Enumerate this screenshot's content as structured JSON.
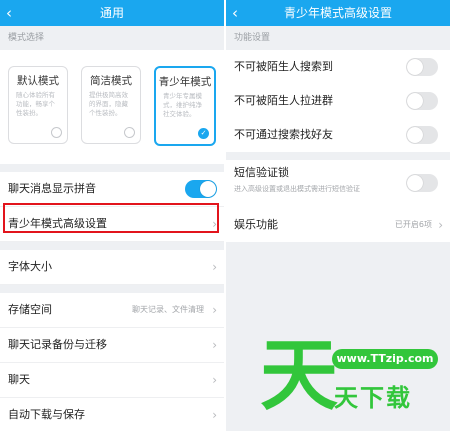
{
  "left": {
    "nav": {
      "back_icon": "‹",
      "title": "通用"
    },
    "mode_section_label": "模式选择",
    "modes": [
      {
        "title": "默认模式",
        "desc": "随心体验所有功能，畅享个性装扮。",
        "selected": false
      },
      {
        "title": "简洁模式",
        "desc": "提供极简高效的界面，隐藏个性装扮。",
        "selected": false
      },
      {
        "title": "青少年模式",
        "desc": "青少年专属模式，维护纯净社交体验。",
        "selected": true
      }
    ],
    "pinyin_row": {
      "label": "聊天消息显示拼音",
      "toggle_on": true
    },
    "teen_settings_row": {
      "label": "青少年模式高级设置"
    },
    "font_row": {
      "label": "字体大小"
    },
    "storage_row": {
      "label": "存储空间",
      "hint": "聊天记录、文件清理"
    },
    "backup_row": {
      "label": "聊天记录备份与迁移"
    },
    "chat_row": {
      "label": "聊天"
    },
    "autodl_row": {
      "label": "自动下载与保存"
    }
  },
  "right": {
    "nav": {
      "back_icon": "‹",
      "title": "青少年模式高级设置"
    },
    "section_label": "功能设置",
    "rows": [
      {
        "label": "不可被陌生人搜索到",
        "toggle_on": false
      },
      {
        "label": "不可被陌生人拉进群",
        "toggle_on": false
      },
      {
        "label": "不可通过搜索找好友",
        "toggle_on": false
      }
    ],
    "sms_row": {
      "label": "短信验证锁",
      "sub": "进入高级设置或退出模式需进行短信验证",
      "toggle_on": false
    },
    "ent_row": {
      "label": "娱乐功能",
      "hint": "已开启6项"
    }
  },
  "watermark": {
    "big": "天",
    "url": "www.TTzip.com",
    "sub": "天下载"
  },
  "colors": {
    "accent": "#1aa7ef",
    "highlight": "#e2141c",
    "watermark": "#32c63b"
  },
  "chevron": "›",
  "check": "✓"
}
